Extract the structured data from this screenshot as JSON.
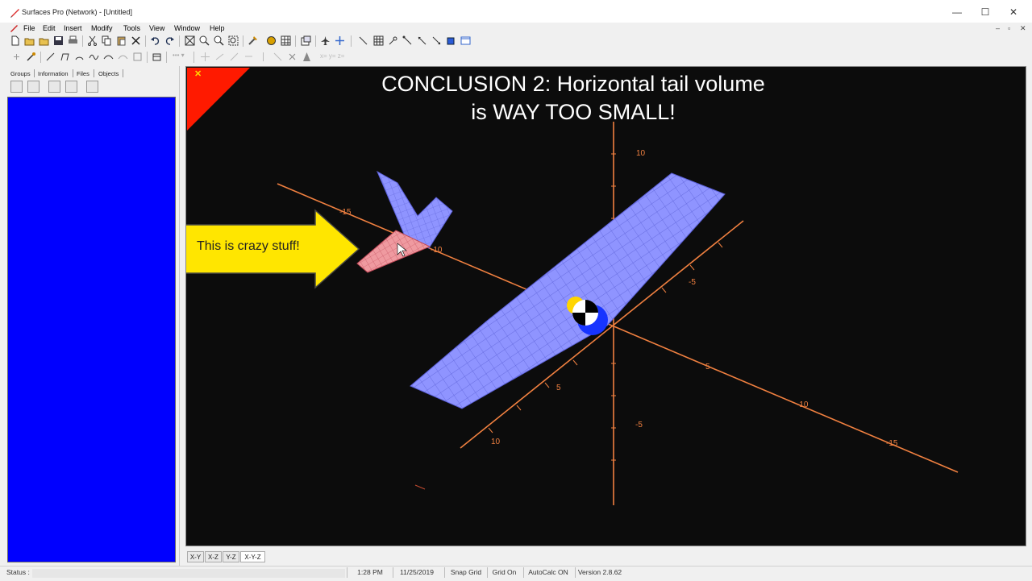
{
  "window": {
    "title": "Surfaces Pro (Network) - [Untitled]",
    "controls": [
      "—",
      "☐",
      "✕"
    ]
  },
  "menu": {
    "items": [
      "File",
      "Edit",
      "Insert",
      "Modify",
      "Tools",
      "View",
      "Window",
      "Help"
    ],
    "mdi_controls": [
      "–",
      "▫",
      "✕"
    ]
  },
  "left_panel": {
    "tabs": [
      "Groups",
      "Information",
      "Files",
      "Objects"
    ],
    "area_color": "#0000ff"
  },
  "viewport": {
    "close_glyph": "✕",
    "overlay_title_line1": "CONCLUSION 2: Horizontal tail volume",
    "overlay_title_line2": "is WAY TOO SMALL!",
    "callout_text": "This is crazy stuff!",
    "axis_labels": [
      "10",
      "-15",
      "-10",
      "-5",
      "5",
      "-5",
      "5",
      "10",
      "-10",
      "-15",
      "-5"
    ],
    "colors": {
      "axis": "#f08040",
      "wing": "#8f94ff",
      "tail": "#ef9aa0",
      "background": "#0c0c0c",
      "arrow": "#ffe600"
    }
  },
  "view_tabs": [
    "X-Y",
    "X-Z",
    "Y-Z",
    "X-Y-Z"
  ],
  "status": {
    "label": "Status :",
    "time": "1:28 PM",
    "date": "11/25/2019",
    "snap": "Snap Grid",
    "grid": "Grid On",
    "autocalc": "AutoCalc ON",
    "version": "Version 2.8.62"
  }
}
